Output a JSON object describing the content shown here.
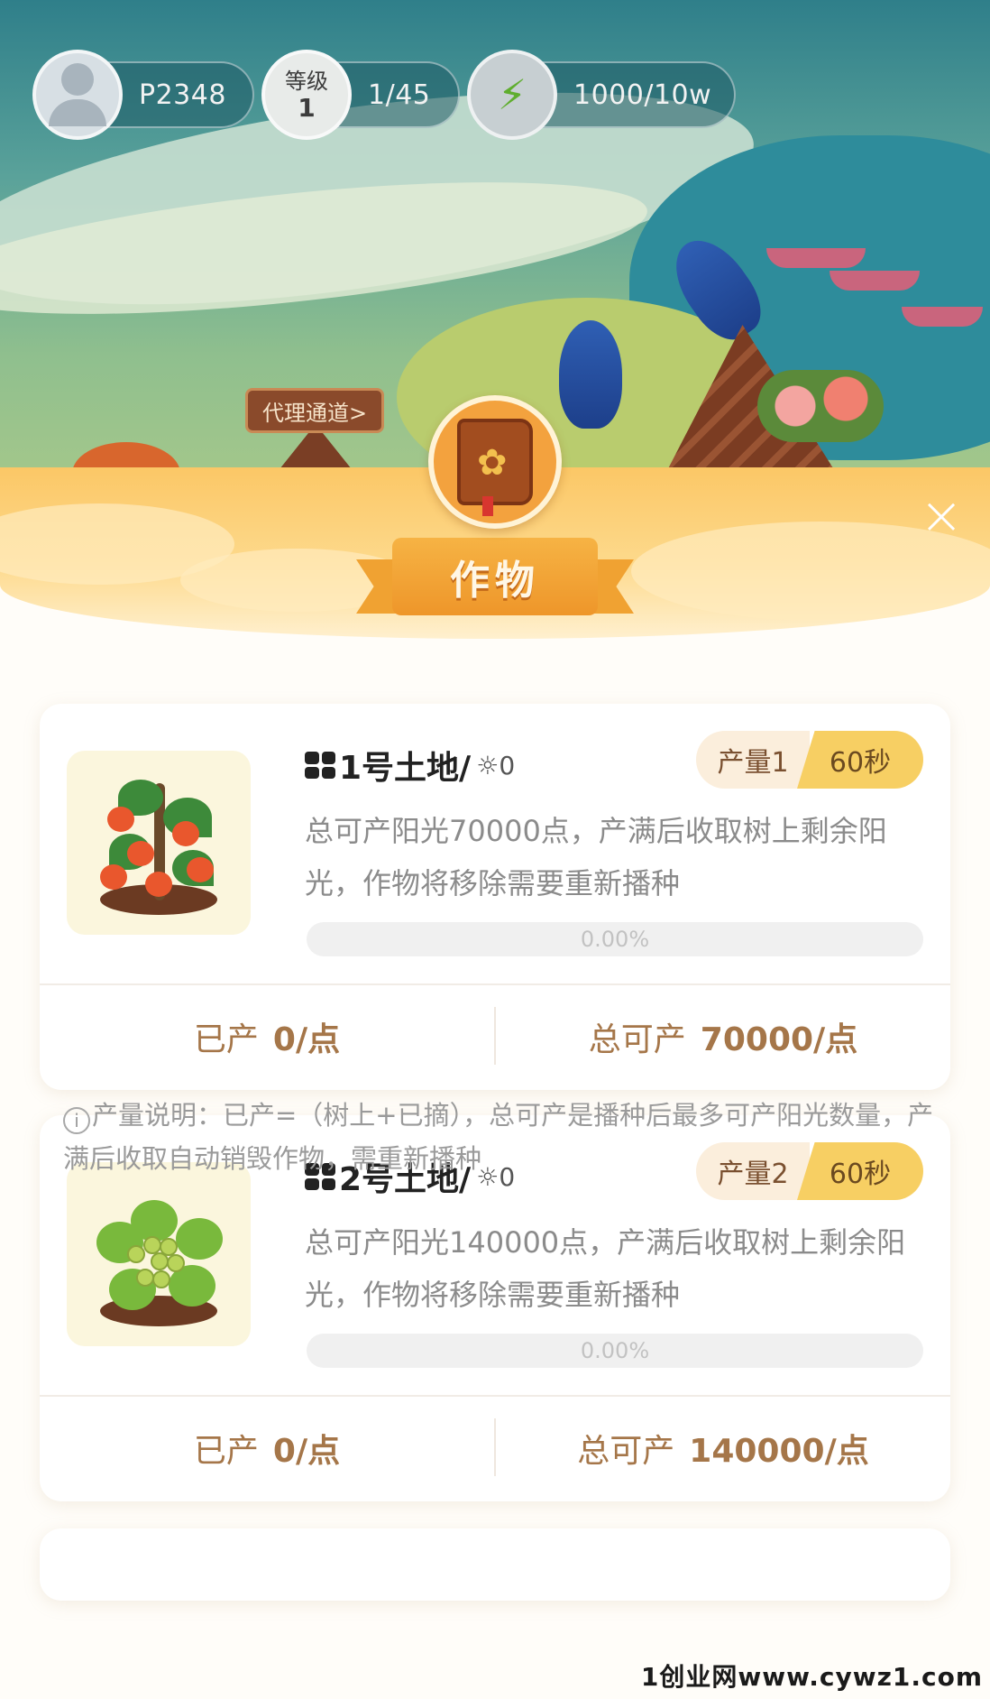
{
  "status": {
    "user_id": "P2348",
    "level_label": "等级",
    "level_value": "1",
    "level_progress": "1/45",
    "energy": "1000/10w"
  },
  "agent_link": "代理通道>",
  "sheet": {
    "title": "作物",
    "close_icon": "×"
  },
  "cards": [
    {
      "title": "1号土地/",
      "sun_value": "0",
      "yield_label": "产量1",
      "time_label": "60秒",
      "description": "总可产阳光70000点，产满后收取树上剩余阳光，作物将移除需要重新播种",
      "progress_text": "0.00%",
      "progress_fraction": 0,
      "produced_label": "已产",
      "produced_value": "0/点",
      "total_label": "总可产",
      "total_value": "70000/点",
      "plant": "persimmon-tree-icon"
    },
    {
      "title": "2号土地/",
      "sun_value": "0",
      "yield_label": "产量2",
      "time_label": "60秒",
      "description": "总可产阳光140000点，产满后收取树上剩余阳光，作物将移除需要重新播种",
      "progress_text": "0.00%",
      "progress_fraction": 0,
      "produced_label": "已产",
      "produced_value": "0/点",
      "total_label": "总可产",
      "total_value": "140000/点",
      "plant": "grape-vine-icon"
    }
  ],
  "note": "产量说明：已产=（树上+已摘），总可产是播种后最多可产阳光数量，产满后收取自动销毁作物，需重新播种",
  "watermark": "1创业网www.cywz1.com",
  "colors": {
    "accent": "#f7cf63",
    "banner": "#ee962a",
    "stat_text": "#a57649"
  }
}
